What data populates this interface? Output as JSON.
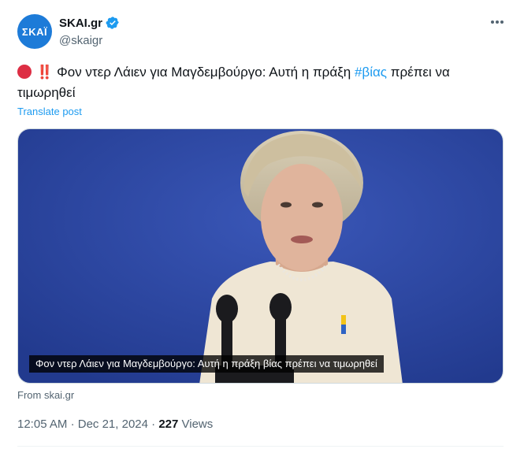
{
  "account": {
    "avatar_text": "ΣΚΑΪ",
    "display_name": "SKAI.gr",
    "handle": "@skaigr",
    "verified": true
  },
  "post": {
    "emoji_prefix": "‼️",
    "text_main": "Φον ντερ Λάιεν για Μαγδεμβούργο: Αυτή η πράξη ",
    "hashtag": "#βίας",
    "text_rest": " πρέπει να τιμωρηθεί",
    "translate_label": "Translate post"
  },
  "media": {
    "caption": "Φον ντερ Λάιεν για Μαγδεμβούργο: Αυτή η πράξη βίας πρέπει να τιμωρηθεί",
    "source": "From skai.gr"
  },
  "meta": {
    "time": "12:05 AM",
    "separator": "·",
    "date": "Dec 21, 2024",
    "views_count": "227",
    "views_label": "Views"
  },
  "colors": {
    "link": "#1d9bf0",
    "verified_badge": "#1d9bf0",
    "avatar_bg": "#1d7bd8",
    "media_bg": "#2f4ba8",
    "red_circle": "#dd2e44"
  },
  "icons": {
    "more": "more-horizontal-icon",
    "verified": "verified-badge-icon"
  }
}
